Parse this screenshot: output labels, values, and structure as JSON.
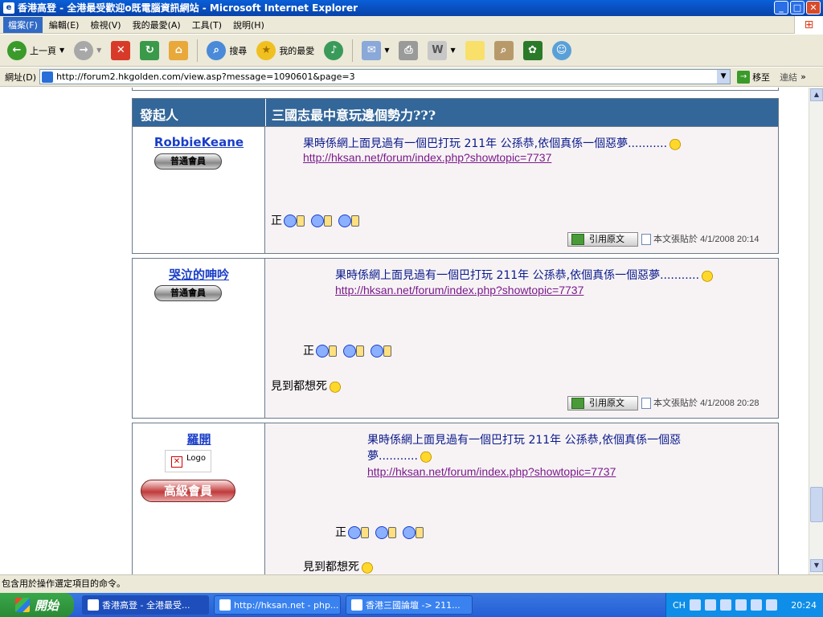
{
  "window": {
    "title": "香港高登 - 全港最受歡迎o既電腦資訊網站 - Microsoft Internet Explorer",
    "minimize": "_",
    "maximize": "□",
    "close": "✕"
  },
  "menu": [
    "檔案(F)",
    "編輯(E)",
    "檢視(V)",
    "我的最愛(A)",
    "工具(T)",
    "說明(H)"
  ],
  "toolbar": {
    "back": "上一頁",
    "search": "搜尋",
    "favorites": "我的最愛"
  },
  "address": {
    "label": "網址(D)",
    "url": "http://forum2.hkgolden.com/view.asp?message=1090601&page=3",
    "go": "移至",
    "links": "連結"
  },
  "thread": {
    "author_header": "發起人",
    "title": "三國志最中意玩邊個勢力???"
  },
  "posts": [
    {
      "username": "RobbieKeane",
      "rank": "普通會員",
      "quote_text": "果時係網上面見過有一個巴打玩 211年 公孫恭,依個真係一個惡夢...........",
      "quote_link": "http://hksan.net/forum/index.php?showtopic=7737",
      "reply_prefix": "正",
      "quote_button": "引用原文",
      "posted_label": "本文張貼於",
      "date": "4/1/2008 20:14"
    },
    {
      "username": "哭泣的呻吟",
      "rank": "普通會員",
      "quote_text": "果時係網上面見過有一個巴打玩 211年 公孫恭,依個真係一個惡夢...........",
      "quote_link": "http://hksan.net/forum/index.php?showtopic=7737",
      "nested_prefix": "正",
      "reply_text": "見到都想死",
      "quote_button": "引用原文",
      "posted_label": "本文張貼於",
      "date": "4/1/2008 20:28"
    },
    {
      "username": "羅開",
      "logo_text": "Logo",
      "rank": "高級會員",
      "quote_text_1": "果時係網上面見過有一個巴打玩 211年 公孫恭,依個真係一個惡",
      "quote_text_2": "夢...........",
      "quote_link": "http://hksan.net/forum/index.php?showtopic=7737",
      "nested_prefix": "正",
      "reply_text": "見到都想死"
    }
  ],
  "status": {
    "text": "包含用於操作選定項目的命令。"
  },
  "taskbar": {
    "start": "開始",
    "items": [
      "香港高登 - 全港最受...",
      "http://hksan.net - php...",
      "香港三國論壇 -> 211..."
    ],
    "lang": "CH",
    "clock": "20:24"
  }
}
